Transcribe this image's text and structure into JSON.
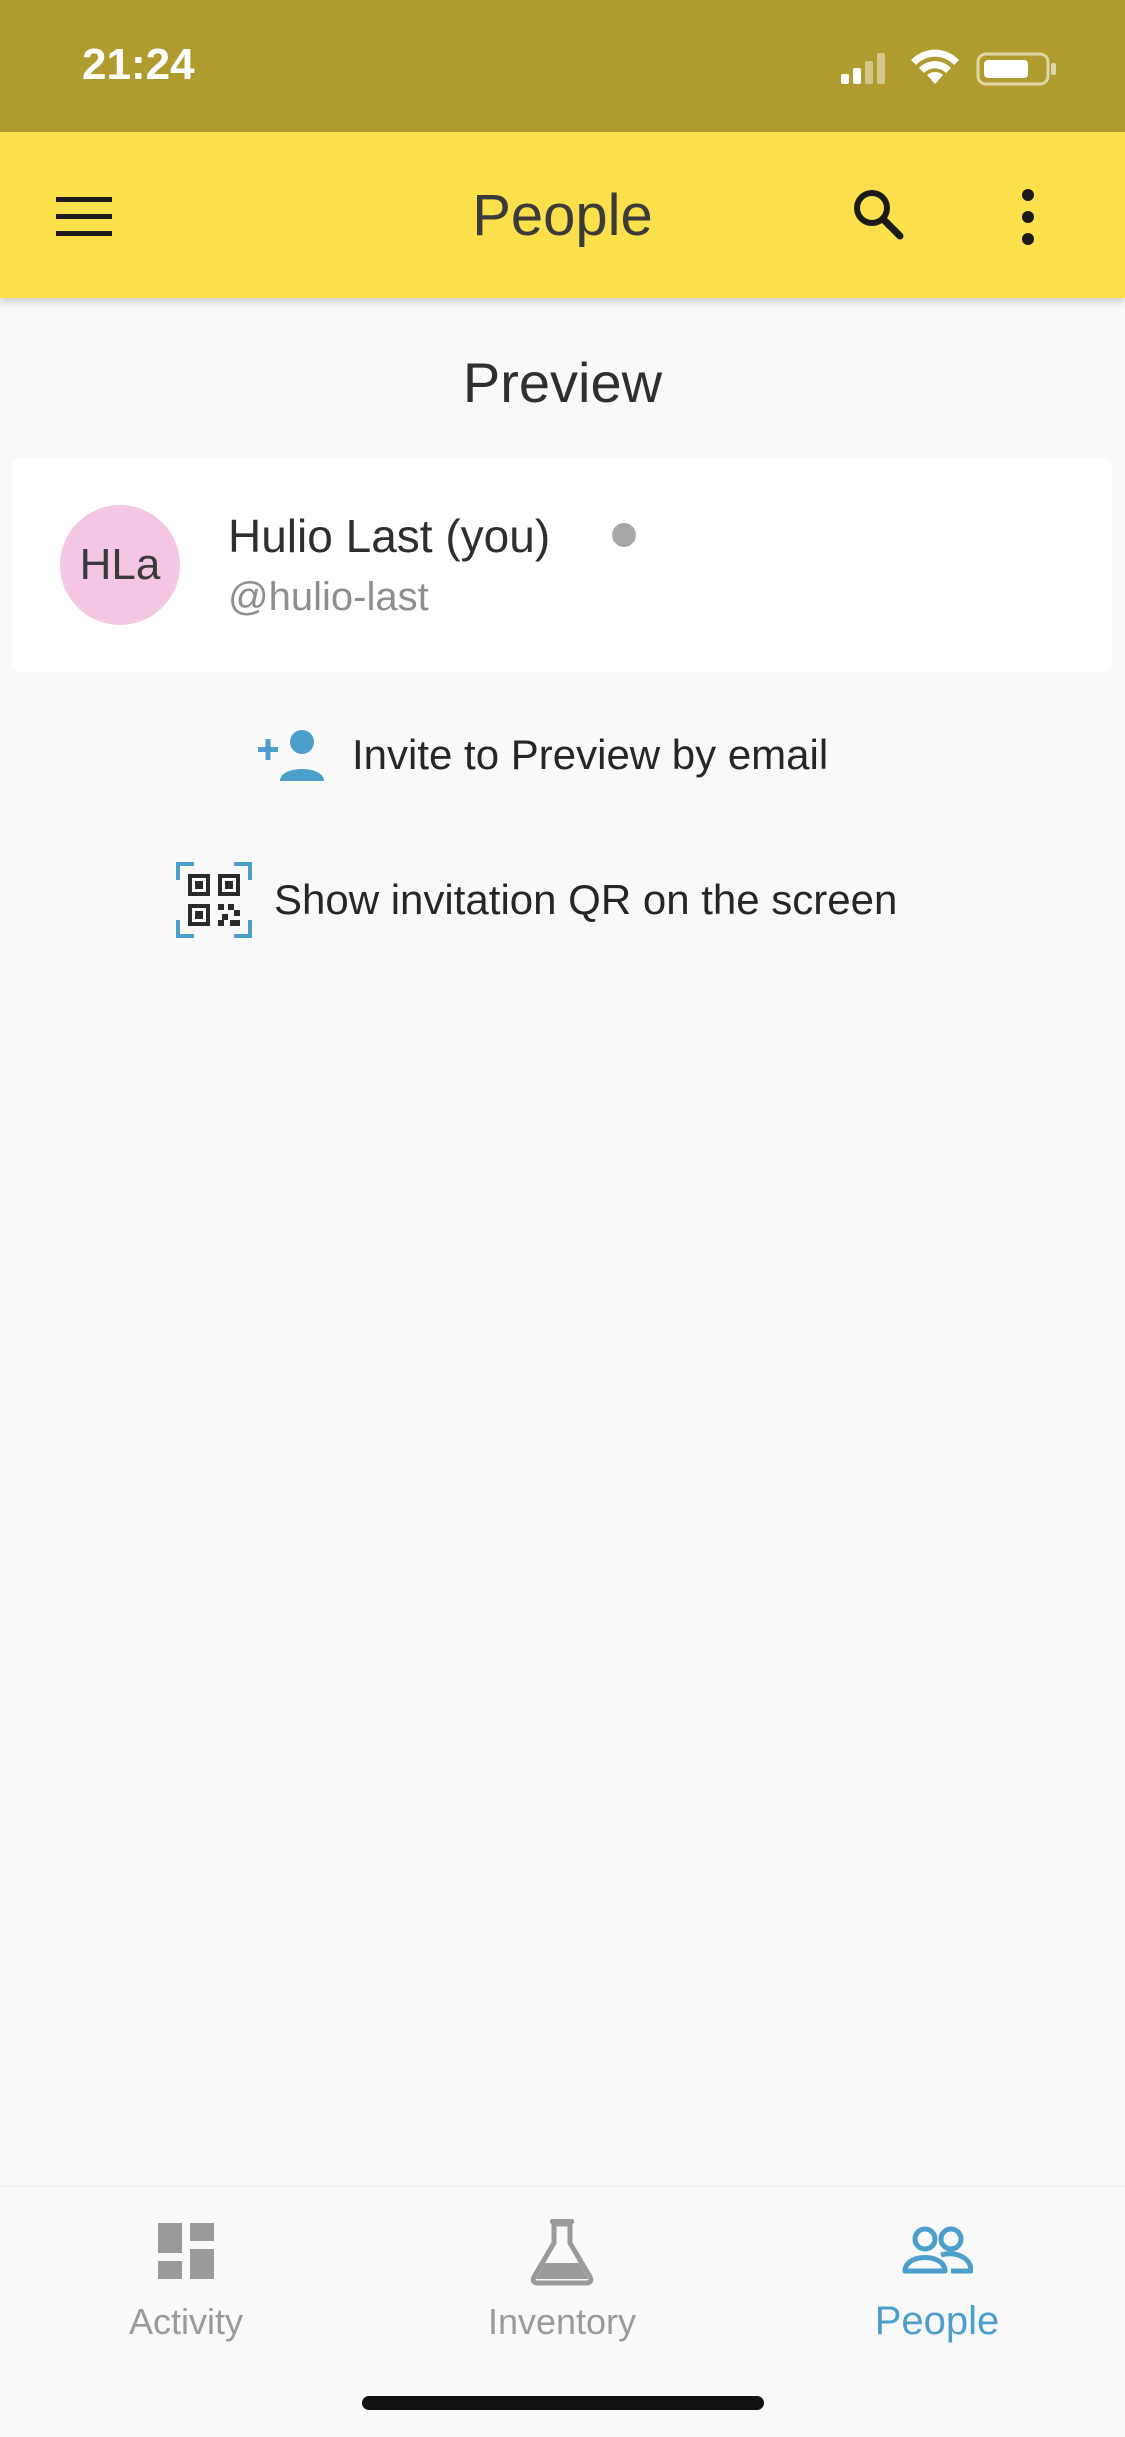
{
  "status_bar": {
    "time": "21:24"
  },
  "app_bar": {
    "title": "People",
    "icons": [
      "menu-icon",
      "search-icon",
      "more-vert-icon"
    ]
  },
  "section": {
    "title": "Preview"
  },
  "member": {
    "initials": "HLa",
    "name": "Hulio Last (you)",
    "handle": "@hulio-last",
    "avatar_color": "#f5c6e3",
    "status_color": "#a8a8a8"
  },
  "actions": {
    "invite_email": {
      "label": "Invite to Preview by email",
      "icon": "person-add-icon"
    },
    "invite_qr": {
      "label": "Show invitation QR on the screen",
      "icon": "qr-code-icon"
    }
  },
  "bottom_nav": {
    "items": [
      {
        "label": "Activity",
        "icon": "dashboard-icon",
        "active": false
      },
      {
        "label": "Inventory",
        "icon": "flask-icon",
        "active": false
      },
      {
        "label": "People",
        "icon": "people-icon",
        "active": true
      }
    ]
  },
  "colors": {
    "status_bar": "#af9b2e",
    "app_bar": "#fbe04b",
    "accent": "#4c9fcd",
    "background": "#f9f9f9"
  }
}
